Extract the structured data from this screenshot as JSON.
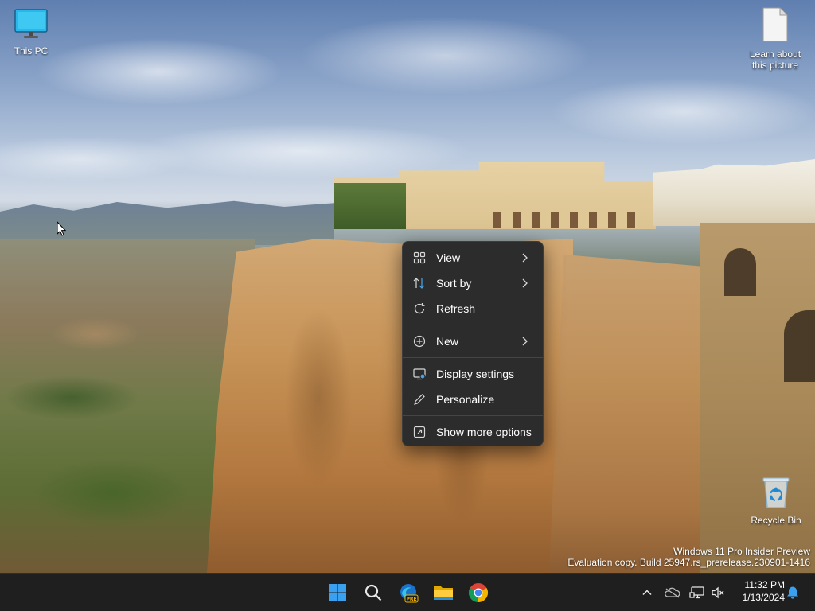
{
  "desktop": {
    "icons": [
      {
        "label": "This PC",
        "icon": "monitor-icon"
      },
      {
        "label": "Learn about this picture",
        "icon": "document-icon"
      },
      {
        "label": "Recycle Bin",
        "icon": "recycle-bin-icon"
      }
    ],
    "watermark": {
      "line1": "Windows 11 Pro Insider Preview",
      "line2": "Evaluation copy. Build 25947.rs_prerelease.230901-1416"
    }
  },
  "context_menu": {
    "items": [
      {
        "label": "View",
        "icon": "grid-icon",
        "submenu": true
      },
      {
        "label": "Sort by",
        "icon": "sort-icon",
        "submenu": true
      },
      {
        "label": "Refresh",
        "icon": "refresh-icon",
        "submenu": false
      },
      {
        "label": "New",
        "icon": "plus-circle-icon",
        "submenu": true
      },
      {
        "label": "Display settings",
        "icon": "display-settings-icon",
        "submenu": false
      },
      {
        "label": "Personalize",
        "icon": "pen-icon",
        "submenu": false
      },
      {
        "label": "Show more options",
        "icon": "show-more-icon",
        "submenu": false
      }
    ]
  },
  "taskbar": {
    "apps": [
      {
        "name": "Start",
        "icon": "windows-start-icon"
      },
      {
        "name": "Search",
        "icon": "search-icon"
      },
      {
        "name": "Microsoft Edge Preview",
        "icon": "edge-preview-icon",
        "badge": "PRE"
      },
      {
        "name": "File Explorer",
        "icon": "folder-icon"
      },
      {
        "name": "Google Chrome",
        "icon": "chrome-icon"
      }
    ],
    "tray": {
      "icons": [
        "chevron-up-icon",
        "onedrive-icon",
        "network-icon",
        "volume-muted-icon"
      ],
      "time": "11:32 PM",
      "date": "1/13/2024",
      "notification_icon": "bell-icon"
    }
  },
  "colors": {
    "menu_bg": "#2c2c2c",
    "taskbar_bg": "#1f1f1f",
    "accent": "#0078d4"
  }
}
